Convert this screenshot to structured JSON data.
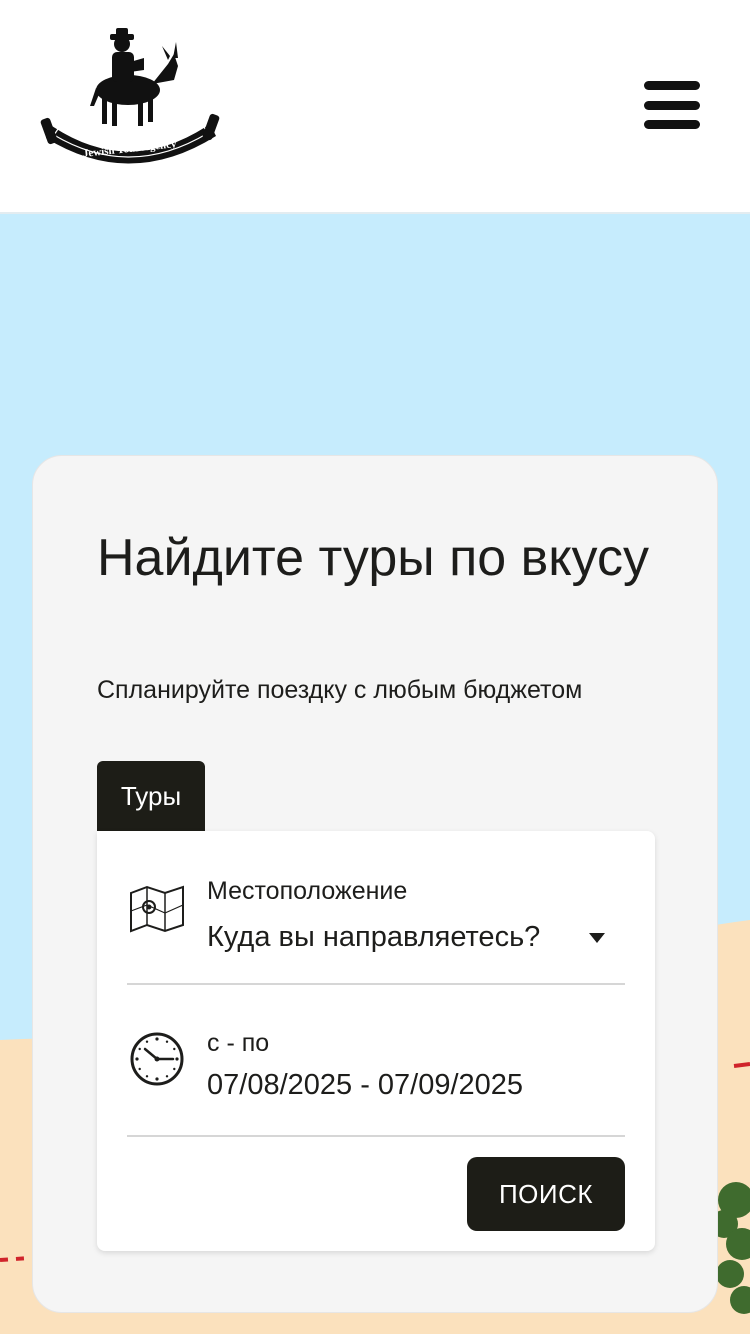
{
  "header": {
    "logo_text": "Jewish Tour Agency"
  },
  "hero": {
    "title": "Найдите туры по вкусу",
    "subtitle": "Спланируйте поездку с любым бюджетом",
    "tabs": [
      {
        "label": "Туры",
        "active": true
      }
    ]
  },
  "search_form": {
    "location": {
      "label": "Местоположение",
      "value": "Куда вы направляетесь?",
      "icon": "map-icon"
    },
    "dates": {
      "label": "с - по",
      "value": "07/08/2025 - 07/09/2025",
      "icon": "clock-icon"
    },
    "search_label": "ПОИСК"
  },
  "colors": {
    "sky": "#c6ecfd",
    "sand": "#fbe1bd",
    "card": "#f5f5f5",
    "dark": "#1d1d17"
  }
}
